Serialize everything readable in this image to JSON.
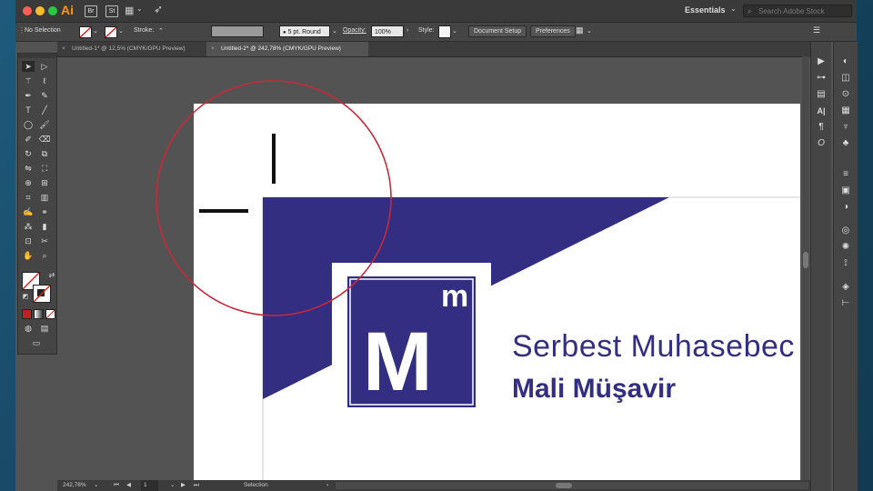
{
  "app": {
    "logo": "Ai",
    "workspace": "Essentials",
    "search_placeholder": "Search Adobe Stock",
    "bridge_label": "Br",
    "stock_label": "St"
  },
  "control_bar": {
    "selection": "No Selection",
    "stroke_label": "Stroke:",
    "brush_label": "5 pt. Round",
    "opacity_label": "Opacity:",
    "opacity_value": "100%",
    "style_label": "Style:",
    "document_setup": "Document Setup",
    "preferences": "Preferences"
  },
  "tabs": [
    {
      "label": "Untitled-1* @ 12,5% (CMYK/GPU Preview)",
      "close": "×"
    },
    {
      "label": "Untitled-2* @ 242,78% (CMYK/GPU Preview)",
      "close": "×"
    }
  ],
  "status_bar": {
    "zoom": "242,78%",
    "page": "1",
    "tool": "Selection"
  },
  "artwork": {
    "logo_big_letter": "M",
    "logo_small_letter": "m",
    "line1": "Serbest Muhasebec",
    "line2": "Mali Müşavir",
    "brand_color": "#332e82",
    "circle_color": "#c8283c"
  }
}
